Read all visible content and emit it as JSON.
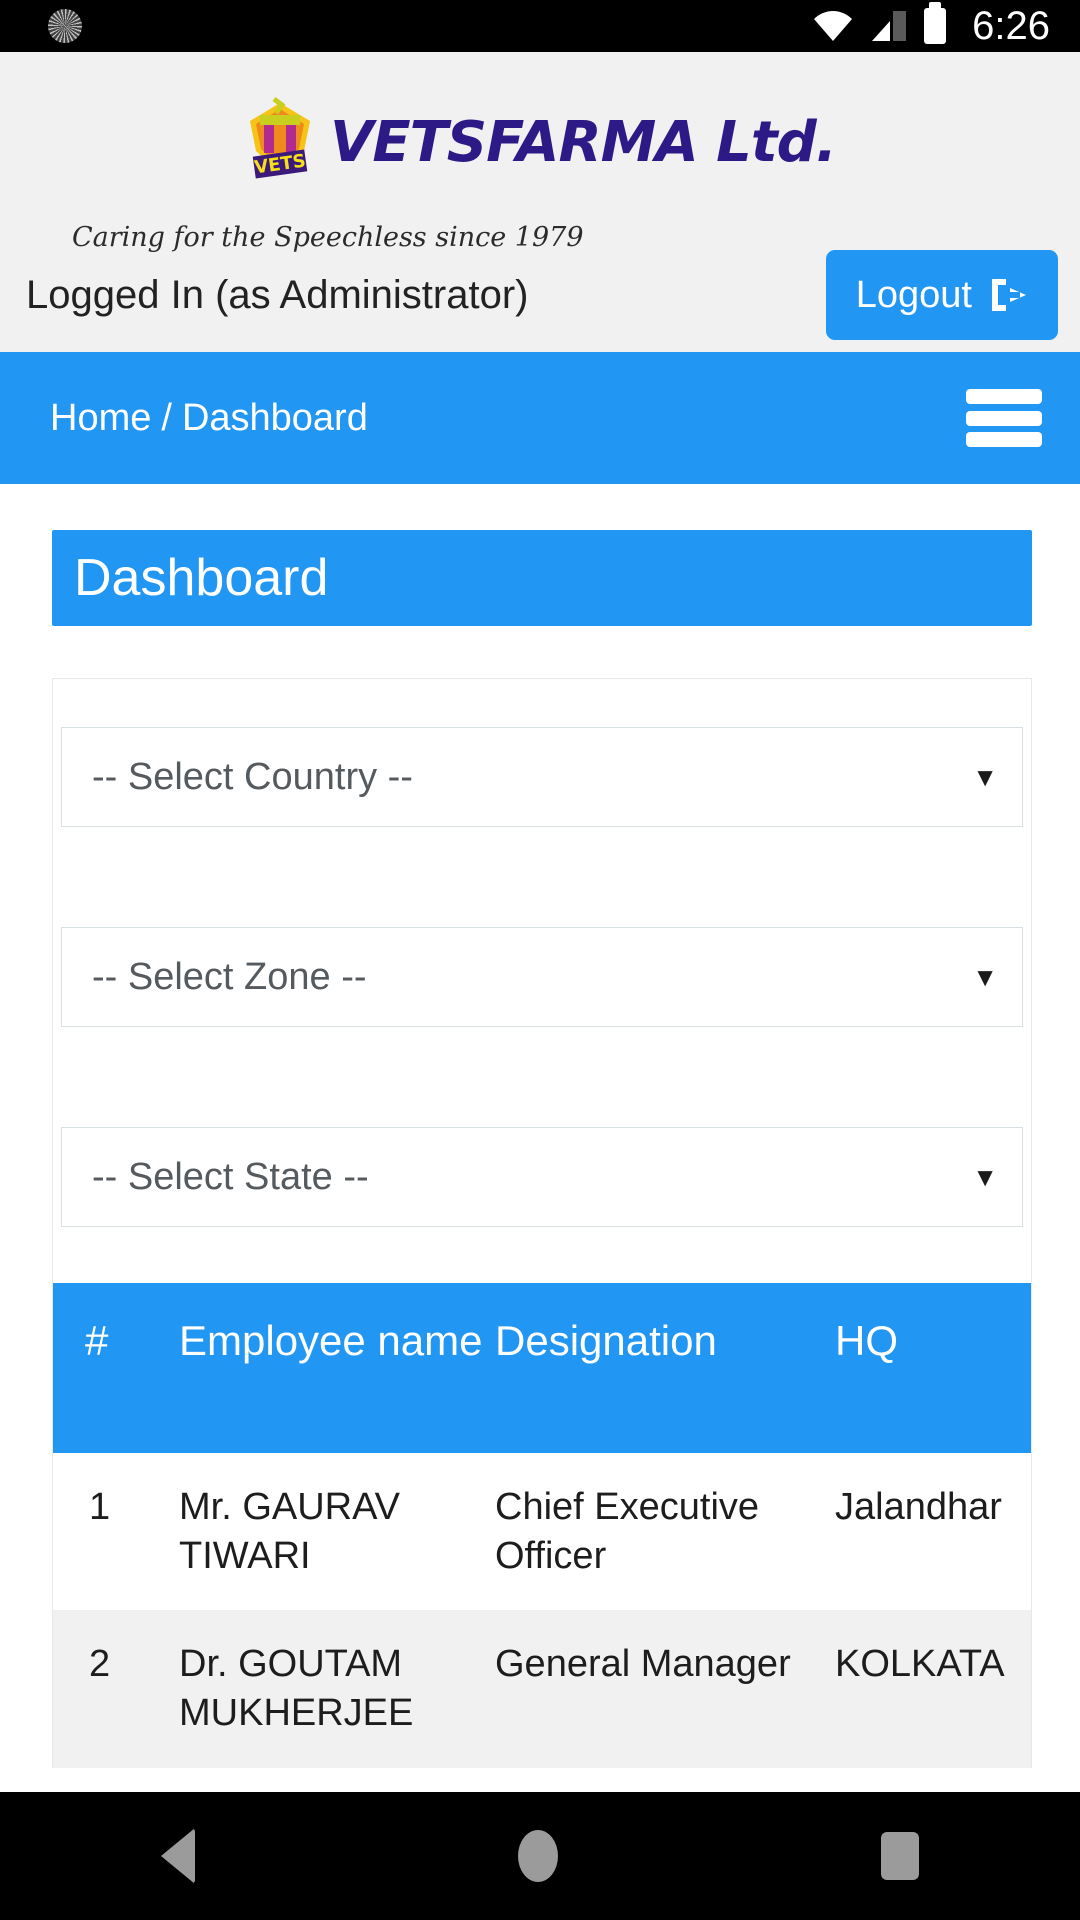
{
  "statusbar": {
    "time": "6:26",
    "icons": [
      "settings-spinner-icon",
      "wifi-icon",
      "cellular-signal-icon",
      "battery-icon"
    ]
  },
  "header": {
    "brand_name": "VETSFARMA Ltd.",
    "tagline": "Caring for the Speechless since 1979",
    "logo_text": "VETS",
    "logged_in_text": "Logged In (as Administrator)",
    "logout_label": "Logout"
  },
  "navbar": {
    "breadcrumb_home": "Home",
    "breadcrumb_sep": "/",
    "breadcrumb_current": "Dashboard",
    "menu_icon": "hamburger-menu-icon"
  },
  "panel": {
    "title": "Dashboard"
  },
  "filters": {
    "country": "-- Select Country --",
    "zone": "-- Select Zone --",
    "state": "-- Select State --",
    "caret": "▼"
  },
  "table": {
    "columns": [
      "#",
      "Employee name",
      "Designation",
      "HQ"
    ],
    "rows": [
      {
        "num": "1",
        "name": "Mr. GAURAV TIWARI",
        "designation": "Chief Executive Officer",
        "hq": "Jalandhar"
      },
      {
        "num": "2",
        "name": "Dr. GOUTAM MUKHERJEE",
        "designation": "General Manager",
        "hq": "KOLKATA"
      }
    ]
  },
  "android_nav": {
    "back": "back-icon",
    "home": "home-icon",
    "recents": "recents-icon"
  },
  "colors": {
    "accent": "#2196f3",
    "header_bg": "#f1f1f1",
    "brand_purple": "#2e1a86",
    "statusbar_bg": "#000000"
  }
}
